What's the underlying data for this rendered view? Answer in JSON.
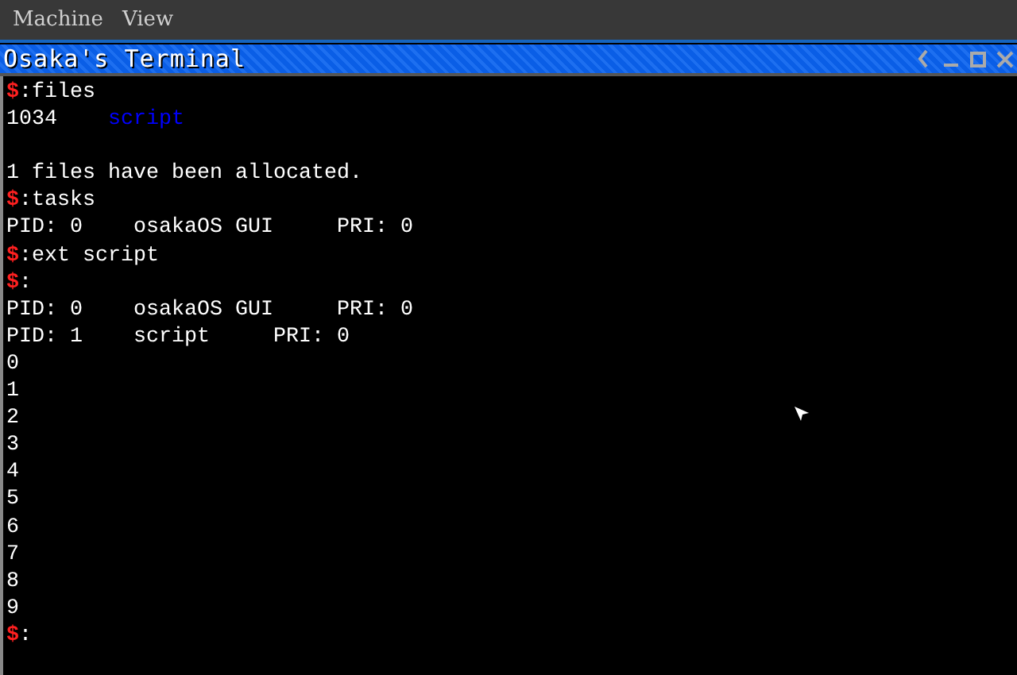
{
  "menu_bar": {
    "items": [
      "Machine",
      "View"
    ]
  },
  "window": {
    "title": "Osaka's Terminal"
  },
  "terminal": {
    "lines": [
      {
        "kind": "prompt",
        "symbol": "$",
        "command": ":files"
      },
      {
        "kind": "output",
        "segments": [
          {
            "text": "1034    ",
            "color": "#ffffff"
          },
          {
            "text": "script",
            "color": "#0000ff"
          }
        ]
      },
      {
        "kind": "blank"
      },
      {
        "kind": "output",
        "segments": [
          {
            "text": "1 files have been allocated.",
            "color": "#ffffff"
          }
        ]
      },
      {
        "kind": "prompt",
        "symbol": "$",
        "command": ":tasks"
      },
      {
        "kind": "output",
        "segments": [
          {
            "text": "PID: 0    osakaOS GUI     PRI: 0",
            "color": "#ffffff"
          }
        ]
      },
      {
        "kind": "prompt",
        "symbol": "$",
        "command": ":ext script"
      },
      {
        "kind": "prompt",
        "symbol": "$",
        "command": ":"
      },
      {
        "kind": "output",
        "segments": [
          {
            "text": "PID: 0    osakaOS GUI     PRI: 0",
            "color": "#ffffff"
          }
        ]
      },
      {
        "kind": "output",
        "segments": [
          {
            "text": "PID: 1    script     PRI: 0",
            "color": "#ffffff"
          }
        ]
      },
      {
        "kind": "output",
        "segments": [
          {
            "text": "0",
            "color": "#ffffff"
          }
        ]
      },
      {
        "kind": "output",
        "segments": [
          {
            "text": "1",
            "color": "#ffffff"
          }
        ]
      },
      {
        "kind": "output",
        "segments": [
          {
            "text": "2",
            "color": "#ffffff"
          }
        ]
      },
      {
        "kind": "output",
        "segments": [
          {
            "text": "3",
            "color": "#ffffff"
          }
        ]
      },
      {
        "kind": "output",
        "segments": [
          {
            "text": "4",
            "color": "#ffffff"
          }
        ]
      },
      {
        "kind": "output",
        "segments": [
          {
            "text": "5",
            "color": "#ffffff"
          }
        ]
      },
      {
        "kind": "output",
        "segments": [
          {
            "text": "6",
            "color": "#ffffff"
          }
        ]
      },
      {
        "kind": "output",
        "segments": [
          {
            "text": "7",
            "color": "#ffffff"
          }
        ]
      },
      {
        "kind": "output",
        "segments": [
          {
            "text": "8",
            "color": "#ffffff"
          }
        ]
      },
      {
        "kind": "output",
        "segments": [
          {
            "text": "9",
            "color": "#ffffff"
          }
        ]
      },
      {
        "kind": "prompt",
        "symbol": "$",
        "command": ":"
      }
    ]
  }
}
